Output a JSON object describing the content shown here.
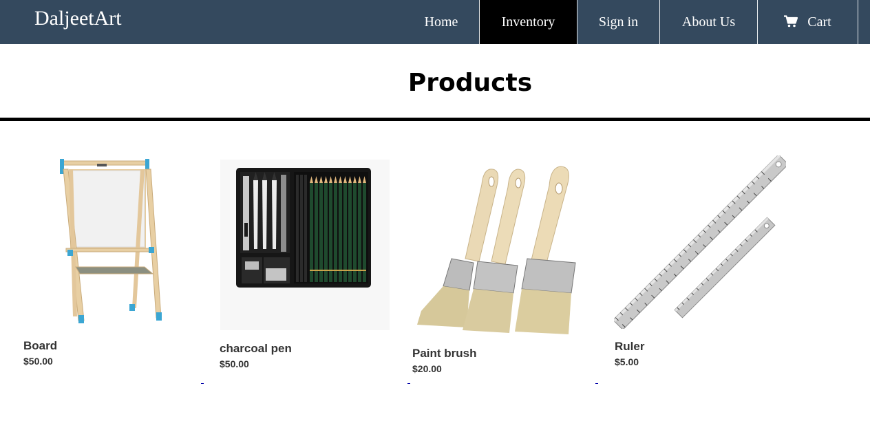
{
  "brand": {
    "name": "DaljeetArt"
  },
  "nav": {
    "items": [
      {
        "label": "Home"
      },
      {
        "label": "Inventory",
        "active": true
      },
      {
        "label": "Sign in"
      },
      {
        "label": "About Us"
      },
      {
        "label": "Cart",
        "icon": "cart-icon"
      }
    ]
  },
  "page": {
    "title": "Products"
  },
  "products": [
    {
      "name": "Board",
      "price": "$50.00",
      "image_icon": "easel-image"
    },
    {
      "name": "charcoal pen",
      "price": "$50.00",
      "image_icon": "pencil-set-image"
    },
    {
      "name": "Paint brush",
      "price": "$20.00",
      "image_icon": "paint-brushes-image"
    },
    {
      "name": "Ruler",
      "price": "$5.00",
      "image_icon": "steel-rulers-image"
    }
  ],
  "colors": {
    "nav_bg": "#34495e",
    "nav_active": "#000000",
    "text": "#333333"
  }
}
